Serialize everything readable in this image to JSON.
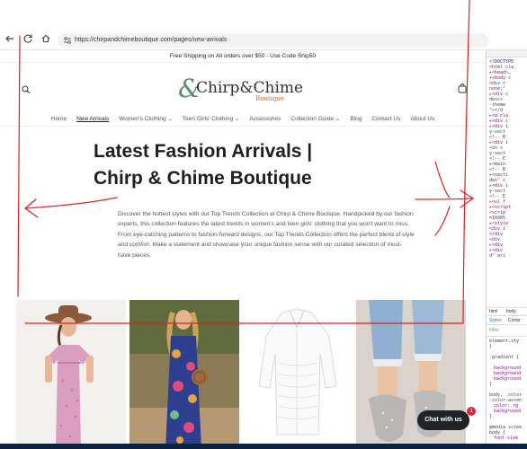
{
  "browser": {
    "url": "https://chirpandchimeboutique.com/pages/new-arrivals",
    "back_icon": "arrow-left-icon",
    "reload_icon": "reload-icon",
    "home_icon": "home-icon"
  },
  "announcement": "Free Shipping on All orders over $50 - Use Code Ship50",
  "logo": {
    "main": "Chirp&Chime",
    "sub": "Boutique"
  },
  "nav": [
    "Home",
    "New Arrivals",
    "Women's Clothing ⌄",
    "Teen Girls' Clothing ⌄",
    "Accessories",
    "Collection Guide ⌄",
    "Blog",
    "Contact Us",
    "About Us"
  ],
  "page": {
    "title": "Latest Fashion Arrivals | Chirp & Chime Boutique",
    "description": "Discover the hottest styles with our Top Trends Collection at Chirp & Chime Boutique. Handpicked by our fashion experts, this collection features the latest trends in women's and teen girls' clothing that you won't want to miss. From eye-catching patterns to fashion-forward designs, our Top Trends Collection offers the perfect blend of style and comfort. Make a statement and showcase your unique fashion sense with our curated selection of must-have pieces."
  },
  "chat": {
    "label": "Chat with us",
    "badge": "1"
  },
  "devtools": {
    "lines": [
      "<!DOCTYPE",
      "<html cla",
      "▸<head>…",
      "▾<body c",
      "<div c",
      "none;\"",
      "▸<div c",
      "descr",
      "-theme",
      "\"></d",
      "▸<a cla",
      "▸<div c",
      "▸<div i",
      "y-sect",
      "<!-- B",
      "▸<div i",
      "<on s",
      "y-sect",
      "<!-- E",
      "▸<main",
      "<!-- B",
      "▸<secti",
      "dex\" c",
      "▸<div i",
      "y-sect",
      "<!-- E",
      "▸<ul f",
      "▸<script",
      "<scrip",
      "=16085",
      "▸<style",
      "<div i",
      "</div",
      "<div",
      "▸<div",
      "▸<div",
      "d\" ari"
    ],
    "tabs": [
      "html",
      "body"
    ],
    "styles_tab": "Styles",
    "computed_tab": "Comp",
    "filter": "Filter",
    "rules": [
      "element.sty",
      "}",
      ".gradient {",
      "background",
      "background",
      "background",
      "}",
      "body, .color",
      ".color-accen",
      "color: rg",
      "background",
      "}",
      "@media scree",
      "body {",
      "font-size"
    ]
  }
}
